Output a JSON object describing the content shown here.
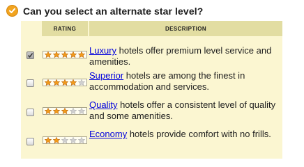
{
  "heading": {
    "text": "Can you select an alternate star level?",
    "icon": "checkmark-circle-icon",
    "icon_color": "#f2a41f"
  },
  "table": {
    "columns": {
      "rating": "RATING",
      "description": "DESCRIPTION"
    },
    "rows": [
      {
        "checked": true,
        "stars_filled": 5,
        "stars_total": 5,
        "link": "Luxury",
        "text": " hotels offer premium level service and amenities."
      },
      {
        "checked": false,
        "stars_filled": 4,
        "stars_total": 5,
        "link": "Superior",
        "text": " hotels are among the finest in accommodation and services."
      },
      {
        "checked": false,
        "stars_filled": 3,
        "stars_total": 5,
        "link": "Quality",
        "text": " hotels offer a consistent level of quality and some amenities."
      },
      {
        "checked": false,
        "stars_filled": 2,
        "stars_total": 5,
        "link": "Economy",
        "text": " hotels provide comfort with no frills."
      }
    ]
  },
  "colors": {
    "panel_bg": "#fbf6d1",
    "header_bg": "#e2dda2",
    "link": "#0000dd",
    "star_fill": "#f29a1a",
    "star_empty": "#cfcfcf"
  }
}
